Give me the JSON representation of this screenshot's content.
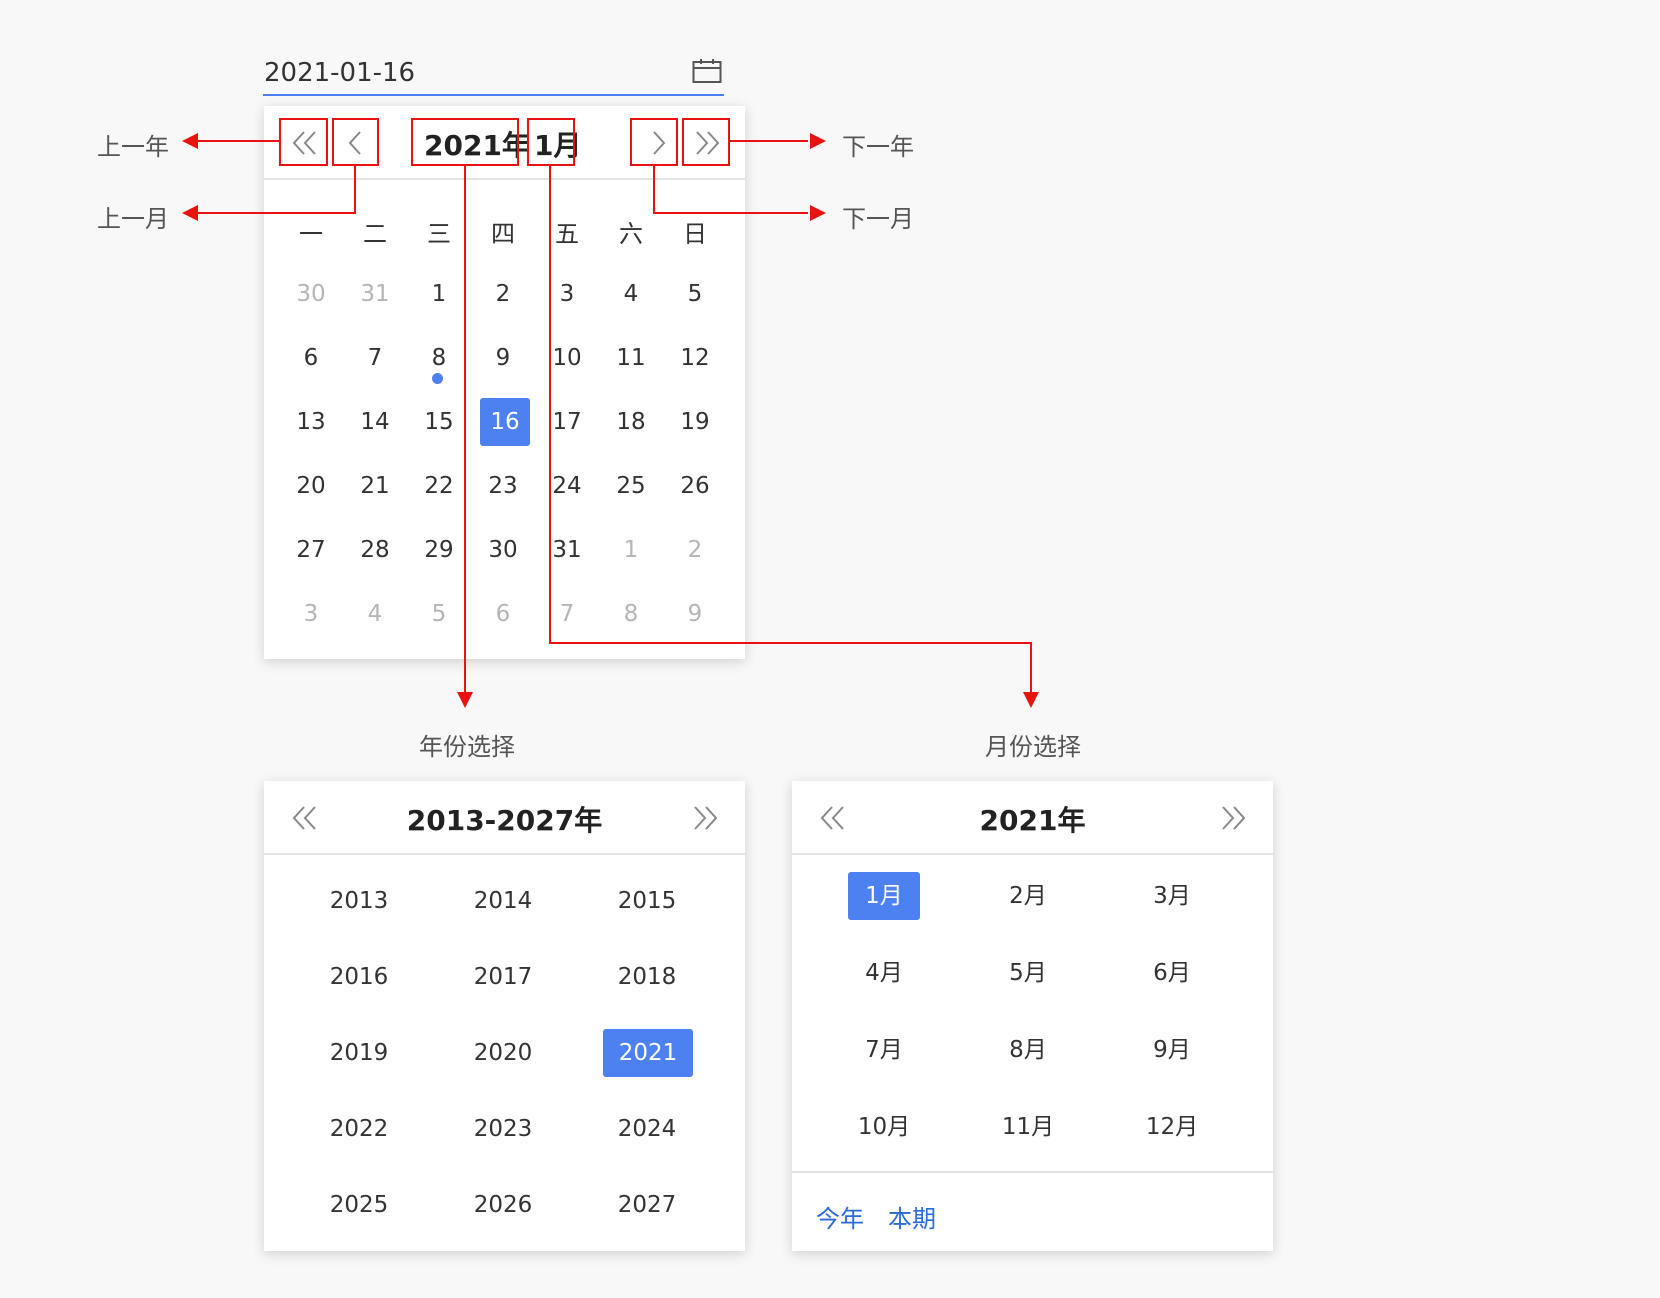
{
  "date_input": {
    "value": "2021-01-16"
  },
  "day_panel": {
    "year_title": "2021年",
    "month_title": "1月",
    "weekdays": [
      "一",
      "二",
      "三",
      "四",
      "五",
      "六",
      "日"
    ],
    "weeks": [
      [
        "30",
        "31",
        "1",
        "2",
        "3",
        "4",
        "5"
      ],
      [
        "6",
        "7",
        "8",
        "9",
        "10",
        "11",
        "12"
      ],
      [
        "13",
        "14",
        "15",
        "16",
        "17",
        "18",
        "19"
      ],
      [
        "20",
        "21",
        "22",
        "23",
        "24",
        "25",
        "26"
      ],
      [
        "27",
        "28",
        "29",
        "30",
        "31",
        "1",
        "2"
      ],
      [
        "3",
        "4",
        "5",
        "6",
        "7",
        "8",
        "9"
      ]
    ],
    "selected_day": "16",
    "today_marker_day": "8"
  },
  "annotations": {
    "prev_year": "上一年",
    "prev_month": "上一月",
    "next_year": "下一年",
    "next_month": "下一月",
    "year_select": "年份选择",
    "month_select": "月份选择"
  },
  "year_panel": {
    "title": "2013-2027年",
    "years": [
      "2013",
      "2014",
      "2015",
      "2016",
      "2017",
      "2018",
      "2019",
      "2020",
      "2021",
      "2022",
      "2023",
      "2024",
      "2025",
      "2026",
      "2027"
    ],
    "selected": "2021"
  },
  "month_panel": {
    "title": "2021年",
    "months": [
      "1月",
      "2月",
      "3月",
      "4月",
      "5月",
      "6月",
      "7月",
      "8月",
      "9月",
      "10月",
      "11月",
      "12月"
    ],
    "selected": "1月",
    "footer": {
      "this_year": "今年",
      "this_period": "本期"
    }
  },
  "colors": {
    "accent": "#4d80f0",
    "annotation": "#ea1111",
    "link": "#2a6cd7",
    "muted": "#b5b5b5"
  },
  "icons": {
    "calendar": "calendar-icon",
    "prev_year": "double-chevron-left-icon",
    "prev_month": "chevron-left-icon",
    "next_month": "chevron-right-icon",
    "next_year": "double-chevron-right-icon"
  }
}
